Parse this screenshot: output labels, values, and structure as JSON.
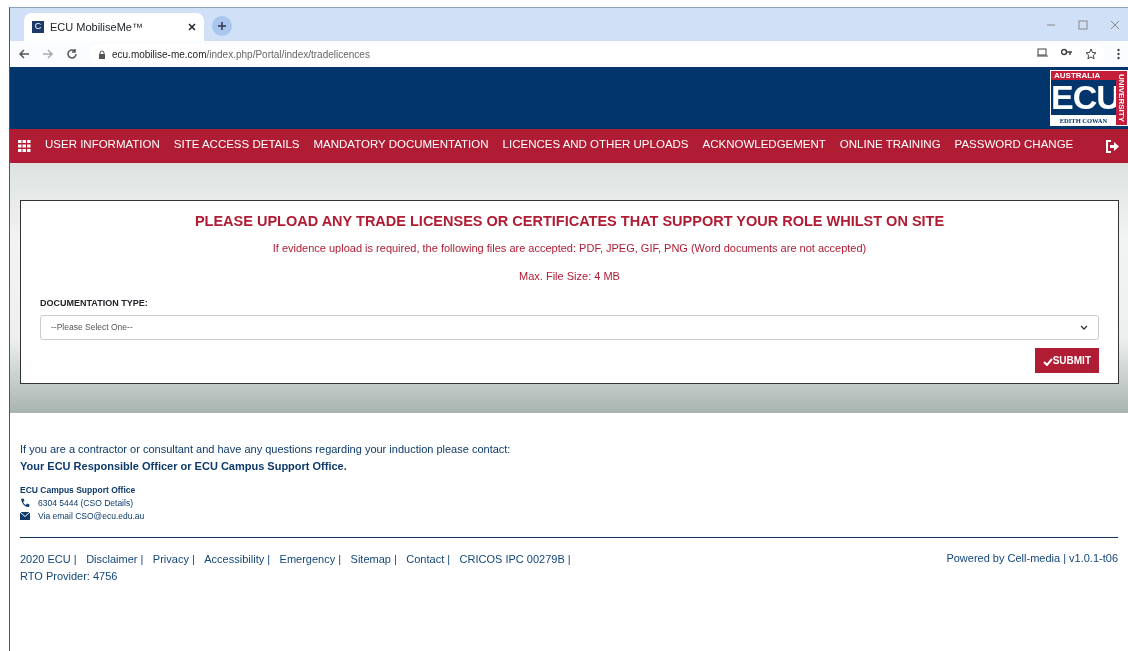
{
  "browser": {
    "tab_title": "ECU MobiliseMe™",
    "favicon": "C",
    "url_host": "ecu.mobilise-me.com",
    "url_path": "/index.php/Portal/index/tradelicences"
  },
  "logo": {
    "top": "AUSTRALIA",
    "letters": "ECU",
    "bottom": "EDITH COWAN",
    "side": "UNIVERSITY"
  },
  "nav": {
    "items": [
      {
        "label": "USER INFORMATION",
        "selected": false
      },
      {
        "label": "SITE ACCESS DETAILS",
        "selected": false
      },
      {
        "label": "MANDATORY DOCUMENTATION",
        "selected": false
      },
      {
        "label": "LICENCES AND OTHER UPLOADS",
        "selected": false
      },
      {
        "label": "ACKNOWLEDGEMENT",
        "selected": false
      },
      {
        "label": "ONLINE TRAINING",
        "selected": false
      },
      {
        "label": "PASSWORD CHANGE",
        "selected": false
      }
    ]
  },
  "form": {
    "heading": "PLEASE UPLOAD ANY TRADE LICENSES OR CERTIFICATES THAT SUPPORT YOUR ROLE WHILST ON SITE",
    "note": "If evidence upload is required, the following files are accepted: PDF, JPEG, GIF, PNG (Word documents are not accepted)",
    "max_size": "Max. File Size: 4 MB",
    "field_label": "DOCUMENTATION TYPE:",
    "select_value": "--Please Select One--",
    "submit": "SUBMIT"
  },
  "contact": {
    "intro": "If you are a contractor or consultant and have any questions regarding your induction please contact:",
    "strong": "Your ECU Responsible Officer or ECU Campus Support Office.",
    "office": "ECU Campus Support Office",
    "phone": "6304 5444 (CSO Details)",
    "email": "Via email CSO@ecu.edu.au"
  },
  "footer": {
    "links": [
      "2020 ECU |",
      "Disclaimer |",
      "Privacy |",
      "Accessibility |",
      "Emergency |",
      "Sitemap |",
      "Contact |",
      "CRICOS IPC 00279B |"
    ],
    "rto": "RTO Provider: 4756",
    "powered": "Powered by Cell-media | v1.0.1-t06"
  }
}
